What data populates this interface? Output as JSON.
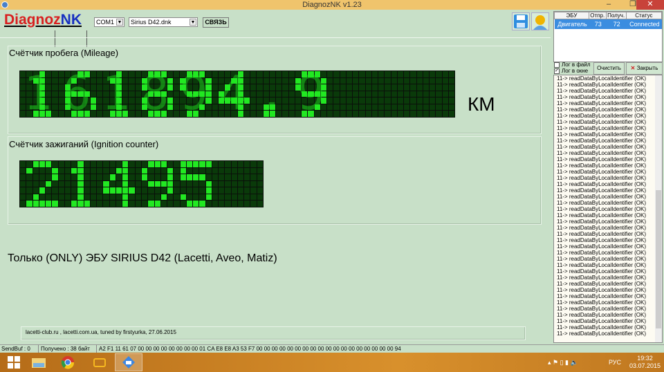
{
  "window": {
    "title": "DiagnozNK v1.23",
    "minimize": "–",
    "maximize": "❐",
    "close": "✕"
  },
  "toolbar": {
    "logo_part1": "Diagnoz",
    "logo_part2": "NK",
    "port": "COM1",
    "profile": "Sirius D42.dnk",
    "connect_label": "СВЯЗЬ",
    "save_icon": "floppy-disk-icon",
    "user_icon": "user-icon"
  },
  "mileage": {
    "title": "Счётчик пробега (Mileage)",
    "value": "161894.9",
    "unit": "КМ"
  },
  "ignition": {
    "title": "Счётчик зажиганий (Ignition counter)",
    "value": "21495"
  },
  "led_colors": {
    "on": "#22e822",
    "off": "#0a3a0a"
  },
  "note": "Только (ONLY) ЭБУ SIRIUS D42 (Lacetti, Aveo, Matiz)",
  "credits": "lacetti-club.ru , lacetti.com.ua, tuned by firstyurka, 27.06.2015",
  "status": {
    "sendbuf": "SendBuf : 0",
    "received": "Получено : 38 байт",
    "bytes": "A2 F1 11 61 07 00 00 00 00 00 00 00 00 01 CA E8 E8 A3 53 F7 00 00 00 00 00 00 00 00 00 00 00 00 00 00 00 00 00 00 94"
  },
  "ecu_table": {
    "headers": [
      "ЭБУ",
      "Отпр.",
      "Получ.",
      "Статус"
    ],
    "rows": [
      [
        "Двигатель",
        "73",
        "72",
        "Connected"
      ]
    ]
  },
  "log_panel": {
    "log_to_file": "Лог в файл",
    "log_to_file_checked": false,
    "log_in_window": "Лог в окне",
    "log_in_window_checked": true,
    "clear_label": "Очистить",
    "close_label": "Закрыть",
    "line": "11-> readDataByLocalIdentifier (OK)"
  },
  "taskbar": {
    "lang": "РУС",
    "time": "19:32",
    "date": "03.07.2015"
  }
}
